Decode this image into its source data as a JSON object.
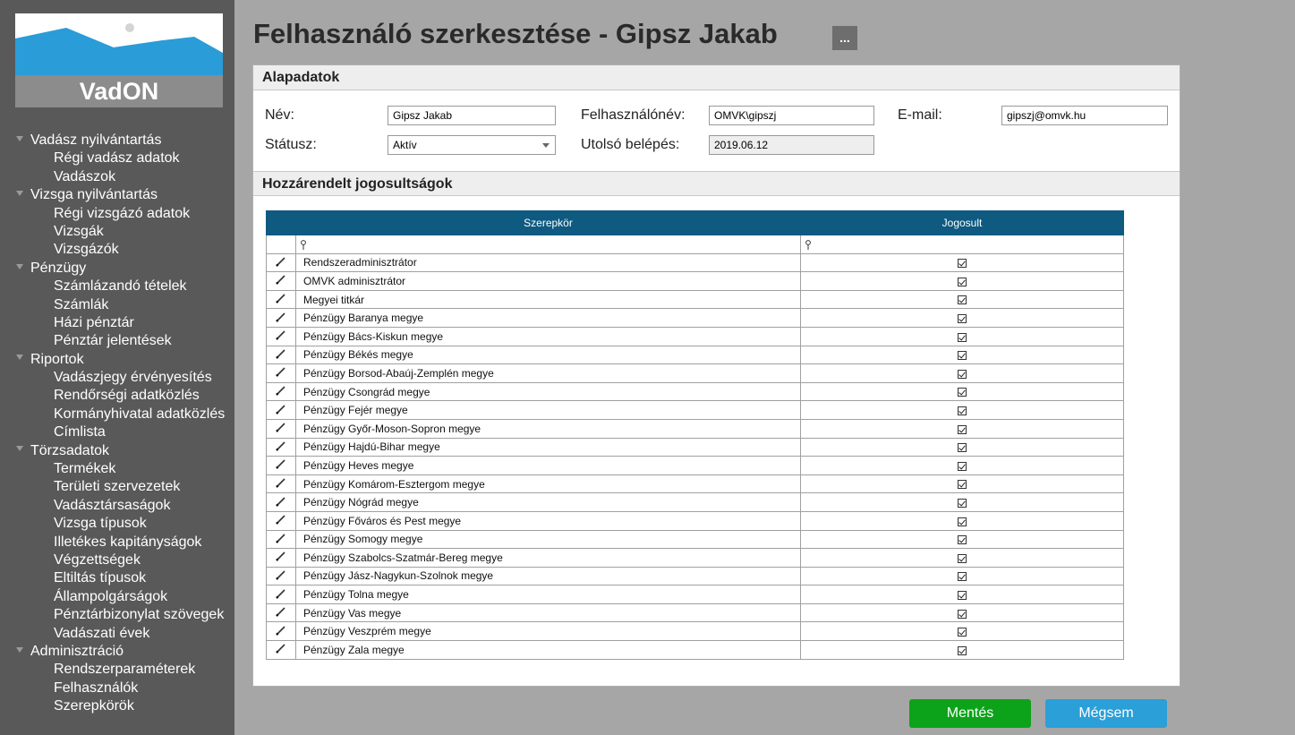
{
  "app": {
    "name": "VadON"
  },
  "sidebar": {
    "groups": [
      {
        "label": "Vadász nyilvántartás",
        "items": [
          "Régi vadász adatok",
          "Vadászok"
        ]
      },
      {
        "label": "Vizsga nyilvántartás",
        "items": [
          "Régi vizsgázó adatok",
          "Vizsgák",
          "Vizsgázók"
        ]
      },
      {
        "label": "Pénzügy",
        "items": [
          "Számlázandó tételek",
          "Számlák",
          "Házi pénztár",
          "Pénztár jelentések"
        ]
      },
      {
        "label": "Riportok",
        "items": [
          "Vadászjegy érvényesítés",
          "Rendőrségi adatközlés",
          "Kormányhivatal adatközlés",
          "Címlista"
        ]
      },
      {
        "label": "Törzsadatok",
        "items": [
          "Termékek",
          "Területi szervezetek",
          "Vadásztársaságok",
          "Vizsga típusok",
          "Illetékes kapitányságok",
          "Végzettségek",
          "Eltiltás típusok",
          "Állampolgárságok",
          "Pénztárbizonylat szövegek",
          "Vadászati évek"
        ]
      },
      {
        "label": "Adminisztráció",
        "items": [
          "Rendszerparaméterek",
          "Felhasználók",
          "Szerepkörök"
        ]
      }
    ]
  },
  "header": {
    "title": "Felhasználó szerkesztése - Gipsz Jakab",
    "more_label": "..."
  },
  "basic": {
    "section_title": "Alapadatok",
    "name_label": "Név:",
    "name_value": "Gipsz Jakab",
    "username_label": "Felhasználónév:",
    "username_value": "OMVK\\gipszj",
    "email_label": "E-mail:",
    "email_value": "gipszj@omvk.hu",
    "status_label": "Státusz:",
    "status_value": "Aktív",
    "last_login_label": "Utolsó belépés:",
    "last_login_value": "2019.06.12"
  },
  "roles": {
    "section_title": "Hozzárendelt jogosultságok",
    "columns": [
      "Szerepkör",
      "Jogosult"
    ],
    "rows": [
      "Rendszeradminisztrátor",
      "OMVK adminisztrátor",
      "Megyei titkár",
      "Pénzügy Baranya megye",
      "Pénzügy Bács-Kiskun megye",
      "Pénzügy Békés megye",
      "Pénzügy Borsod-Abaúj-Zemplén megye",
      "Pénzügy Csongrád megye",
      "Pénzügy Fejér megye",
      "Pénzügy Győr-Moson-Sopron megye",
      "Pénzügy Hajdú-Bihar megye",
      "Pénzügy Heves megye",
      "Pénzügy Komárom-Esztergom megye",
      "Pénzügy Nógrád megye",
      "Pénzügy Főváros és Pest megye",
      "Pénzügy Somogy megye",
      "Pénzügy Szabolcs-Szatmár-Bereg megye",
      "Pénzügy Jász-Nagykun-Szolnok megye",
      "Pénzügy Tolna megye",
      "Pénzügy Vas megye",
      "Pénzügy Veszprém megye",
      "Pénzügy Zala megye"
    ]
  },
  "actions": {
    "save_label": "Mentés",
    "cancel_label": "Mégsem"
  },
  "colors": {
    "table_header": "#0f5a80",
    "save": "#0ca31a",
    "cancel": "#2b9fd8",
    "sidebar": "#595959",
    "background": "#a6a6a6"
  }
}
